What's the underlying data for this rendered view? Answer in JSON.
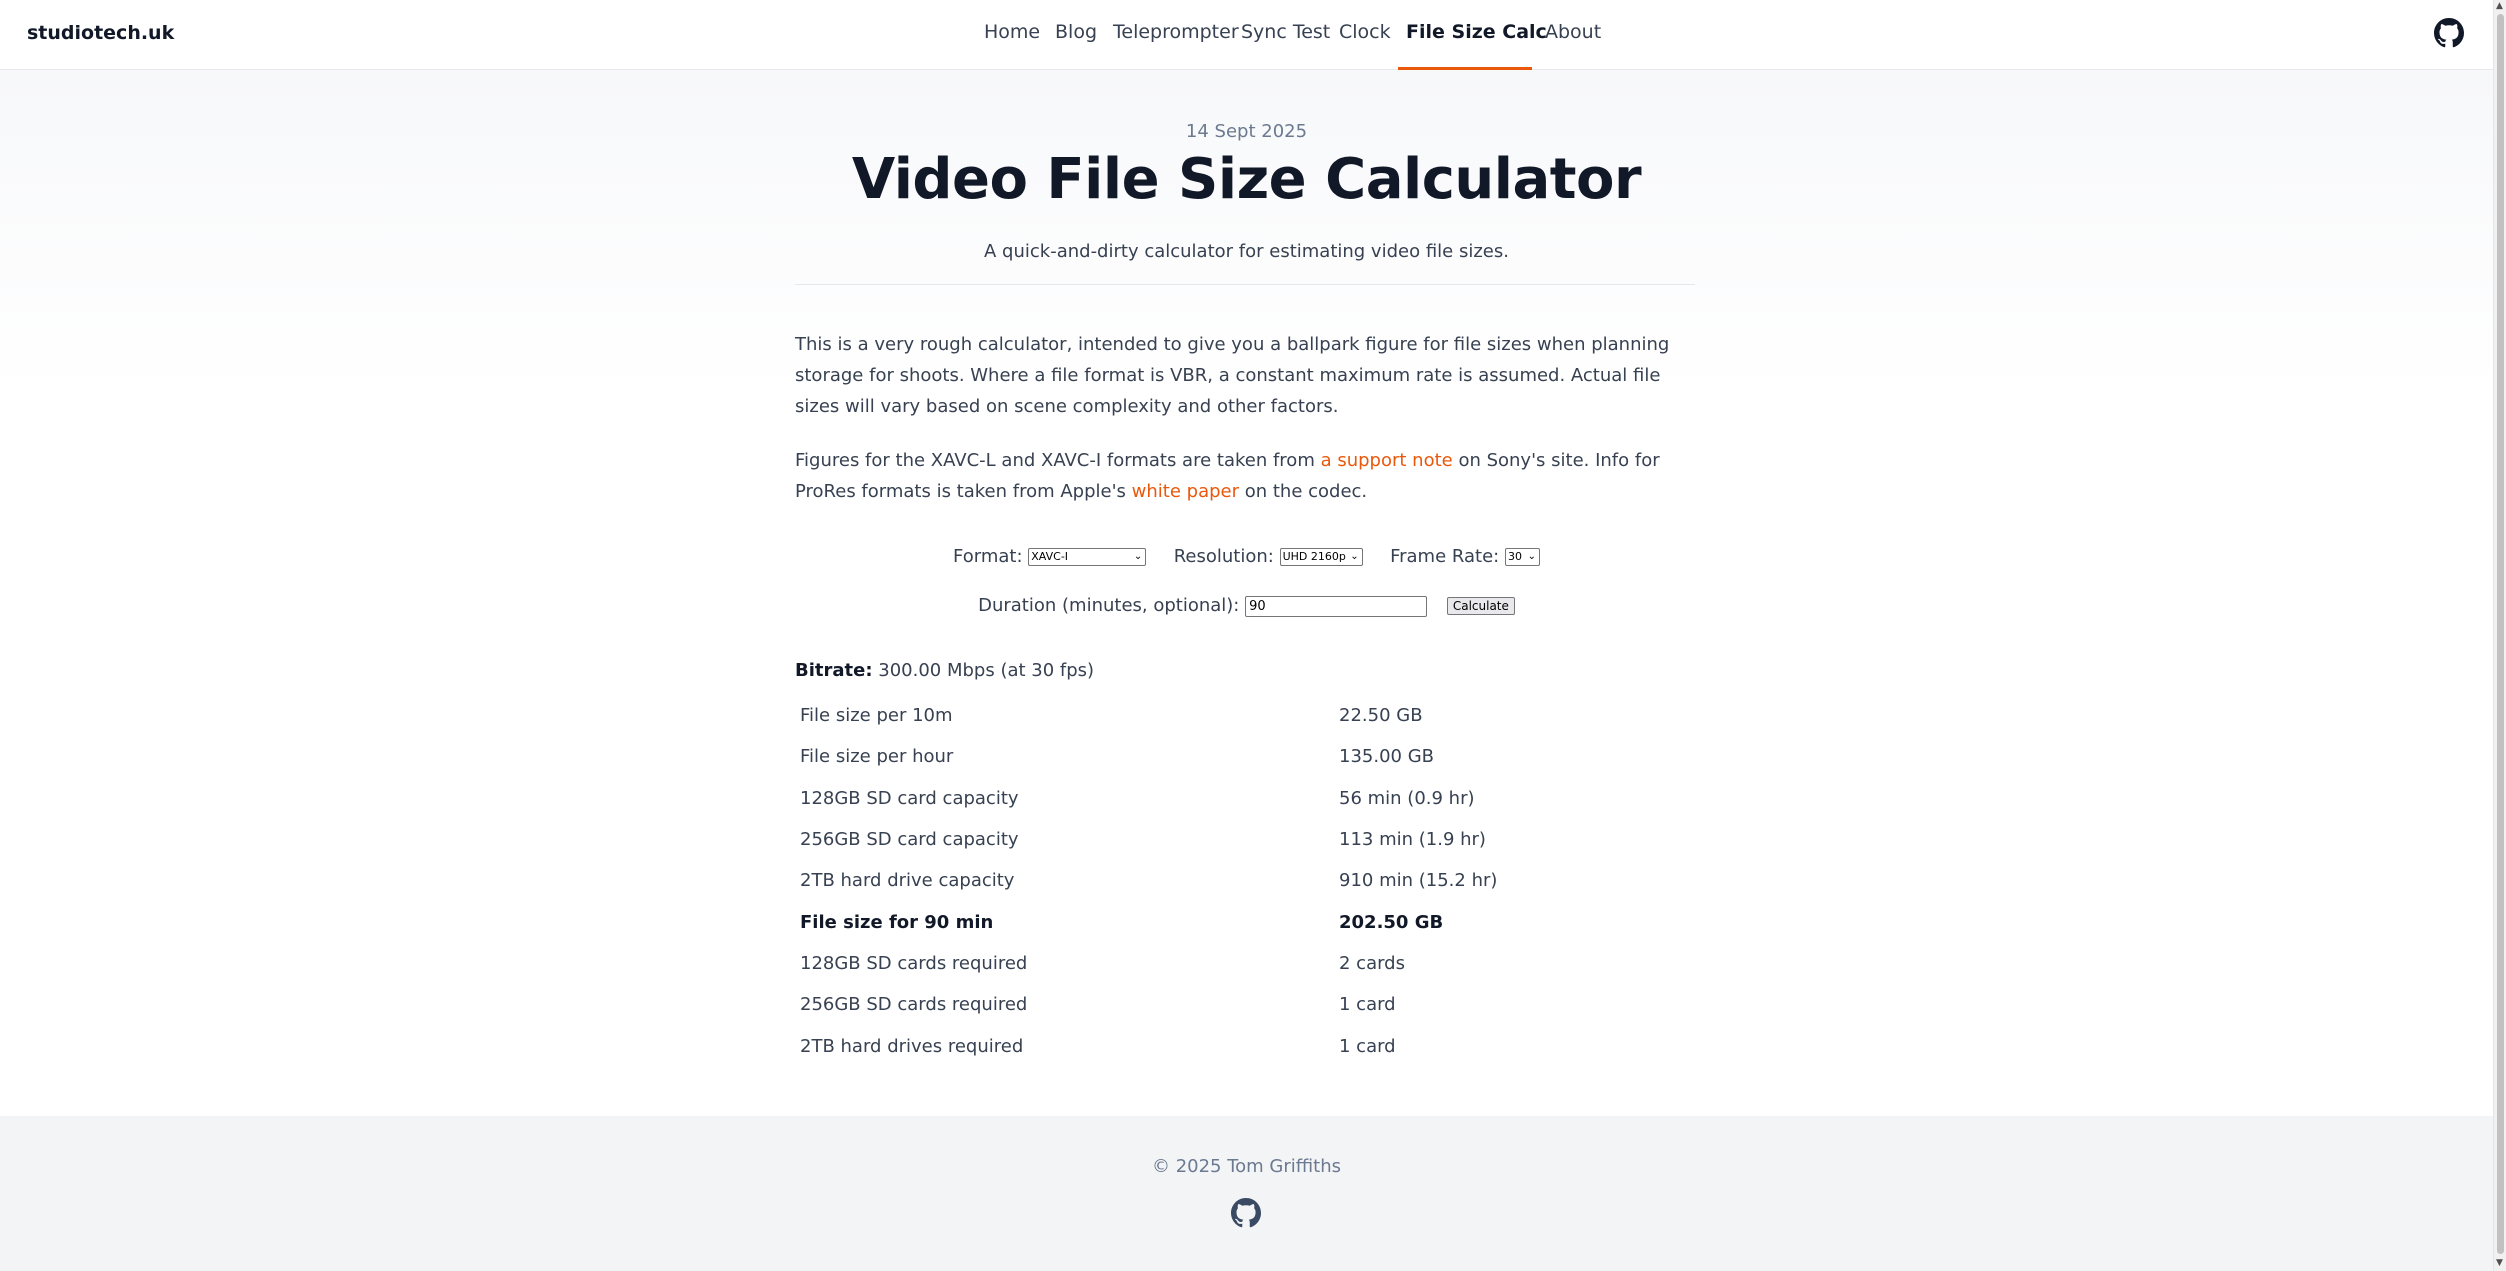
{
  "header": {
    "brand": "studiotech.uk",
    "nav": [
      "Home",
      "Blog",
      "Teleprompter",
      "Sync Test",
      "Clock",
      "File Size Calc",
      "About"
    ],
    "active_nav": "File Size Calc",
    "github_icon": "github-icon"
  },
  "article": {
    "date": "14 Sept 2025",
    "title": "Video File Size Calculator",
    "subtitle": "A quick-and-dirty calculator for estimating video file sizes.",
    "p1": "This is a very rough calculator, intended to give you a ballpark figure for file sizes when planning storage for shoots. Where a file format is VBR, a constant maximum rate is assumed. Actual file sizes will vary based on scene complexity and other factors.",
    "p2_a": "Figures for the XAVC-L and XAVC-I formats are taken from ",
    "p2_link1": "a support note",
    "p2_b": " on Sony's site. Info for ProRes formats is taken from Apple's ",
    "p2_link2": "white paper",
    "p2_c": " on the codec."
  },
  "form": {
    "format_label": "Format:",
    "format_value": "XAVC-I",
    "resolution_label": "Resolution:",
    "resolution_value": "UHD 2160p",
    "framerate_label": "Frame Rate:",
    "framerate_value": "30",
    "duration_label": "Duration (minutes, optional):",
    "duration_value": "90",
    "calculate_label": "Calculate"
  },
  "results": {
    "bitrate_label": "Bitrate:",
    "bitrate_value": "300.00 Mbps (at 30 fps)",
    "rows": [
      {
        "label": "File size per 10m",
        "value": "22.50 GB",
        "bold": false
      },
      {
        "label": "File size per hour",
        "value": "135.00 GB",
        "bold": false
      },
      {
        "label": "128GB SD card capacity",
        "value": "56 min (0.9 hr)",
        "bold": false
      },
      {
        "label": "256GB SD card capacity",
        "value": "113 min (1.9 hr)",
        "bold": false
      },
      {
        "label": "2TB hard drive capacity",
        "value": "910 min (15.2 hr)",
        "bold": false
      },
      {
        "label": "File size for 90 min",
        "value": "202.50 GB",
        "bold": true
      },
      {
        "label": "128GB SD cards required",
        "value": "2 cards",
        "bold": false
      },
      {
        "label": "256GB SD cards required",
        "value": "1 card",
        "bold": false
      },
      {
        "label": "2TB hard drives required",
        "value": "1 card",
        "bold": false
      }
    ]
  },
  "footer": {
    "copyright": "© 2025 Tom Griffiths",
    "github_icon": "github-icon"
  },
  "colors": {
    "accent": "#ea580c",
    "muted": "#6b7a90"
  }
}
